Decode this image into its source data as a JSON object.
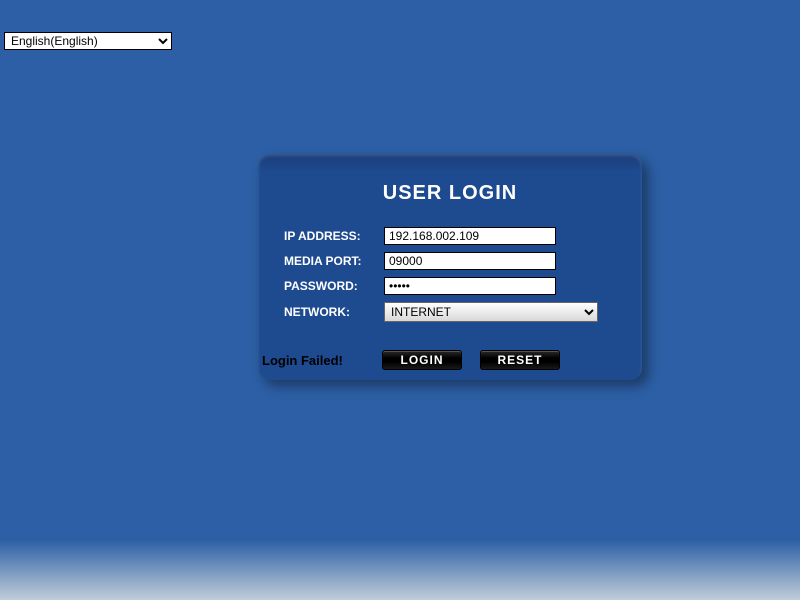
{
  "language": {
    "selected": "English(English)"
  },
  "login": {
    "title": "USER LOGIN",
    "labels": {
      "ip": "IP ADDRESS:",
      "port": "MEDIA PORT:",
      "password": "PASSWORD:",
      "network": "NETWORK:"
    },
    "values": {
      "ip": "192.168.002.109",
      "port": "09000",
      "password": "•••••",
      "network": "INTERNET"
    },
    "buttons": {
      "login": "LOGIN",
      "reset": "RESET"
    },
    "status": "Login Failed!"
  }
}
